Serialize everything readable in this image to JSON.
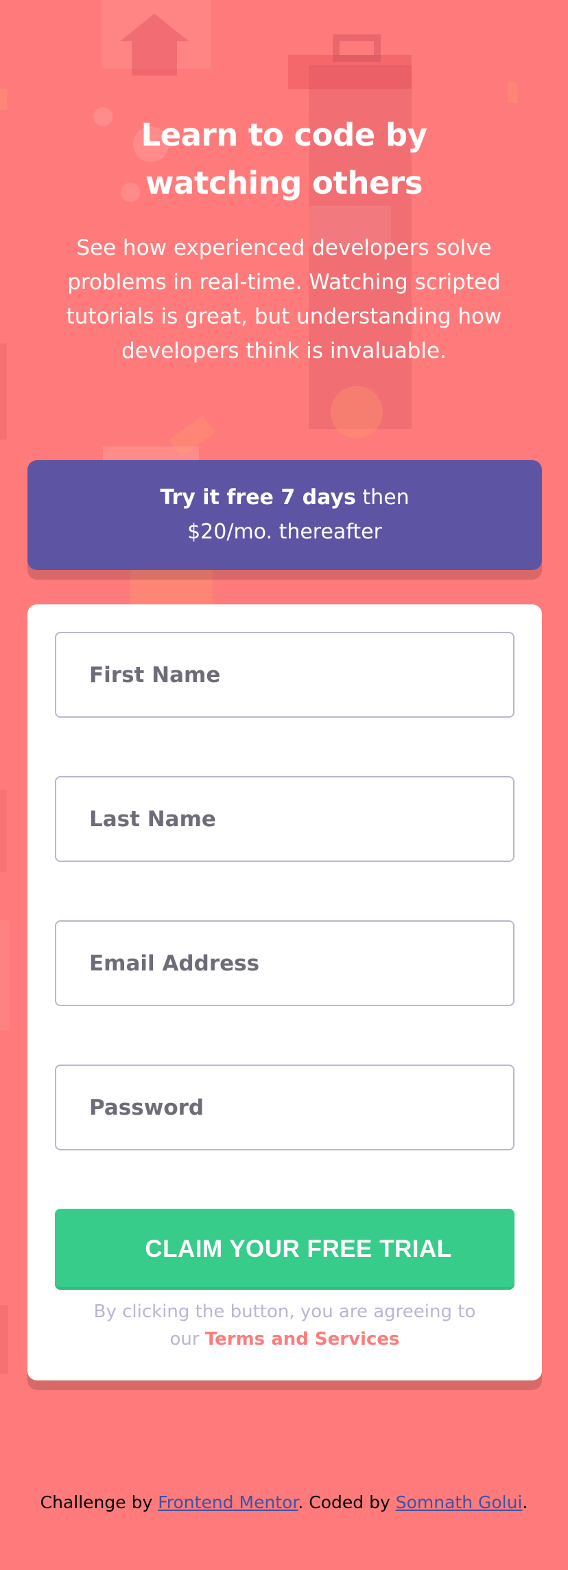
{
  "hero": {
    "title_line1": "Learn to code by",
    "title_line2": "watching others",
    "description": "See how experienced developers solve problems in real-time. Watching scripted tutorials is great, but understanding how developers think is invaluable."
  },
  "trial_banner": {
    "bold_text": "Try it free 7 days",
    "rest_line1": " then",
    "rest_line2": "$20/mo. thereafter"
  },
  "form": {
    "first_name_placeholder": "First Name",
    "last_name_placeholder": "Last Name",
    "email_placeholder": "Email Address",
    "password_placeholder": "Password",
    "submit_label": "CLAIM YOUR FREE TRIAL",
    "terms_prefix": "By clicking the button, you are agreeing to",
    "terms_our": "our",
    "terms_link": "Terms and Services"
  },
  "footer": {
    "challenge_by": "Challenge by",
    "frontend_mentor": "Frontend Mentor",
    "coded_by": ". Coded by",
    "author": "Somnath Golui",
    "end": "."
  },
  "colors": {
    "background": "#ff7b7b",
    "banner": "#5e54a4",
    "submit": "#38cc8b",
    "link_accent": "#ff7b7b",
    "muted_text": "#b9b6d3"
  }
}
